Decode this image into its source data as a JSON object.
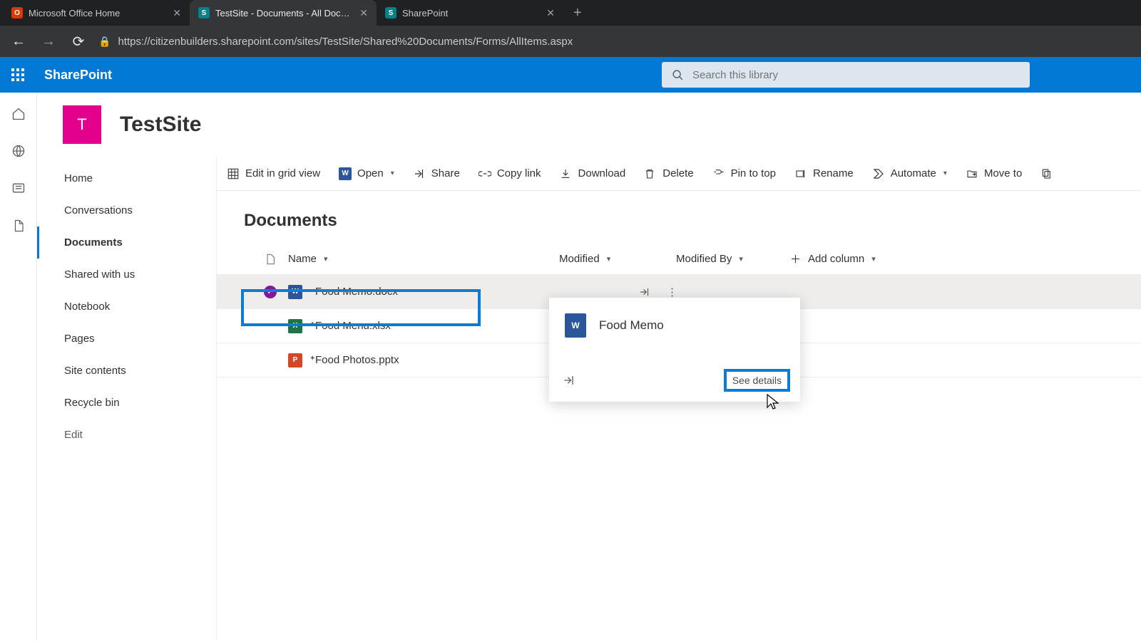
{
  "browser": {
    "tabs": [
      {
        "title": "Microsoft Office Home",
        "favicon": "office"
      },
      {
        "title": "TestSite - Documents - All Docu…",
        "favicon": "sp",
        "active": true
      },
      {
        "title": "SharePoint",
        "favicon": "sp"
      }
    ],
    "url": "https://citizenbuilders.sharepoint.com/sites/TestSite/Shared%20Documents/Forms/AllItems.aspx"
  },
  "suite": {
    "brand": "SharePoint",
    "search_placeholder": "Search this library"
  },
  "site": {
    "logo_letter": "T",
    "title": "TestSite",
    "logo_color": "#e3008c"
  },
  "left_nav": {
    "items": [
      "Home",
      "Conversations",
      "Documents",
      "Shared with us",
      "Notebook",
      "Pages",
      "Site contents",
      "Recycle bin"
    ],
    "selected_index": 2,
    "edit": "Edit"
  },
  "commands": {
    "edit_grid": "Edit in grid view",
    "open": "Open",
    "share": "Share",
    "copy_link": "Copy link",
    "download": "Download",
    "delete": "Delete",
    "pin": "Pin to top",
    "rename": "Rename",
    "automate": "Automate",
    "move": "Move to",
    "copy": "C"
  },
  "library": {
    "title": "Documents",
    "columns": {
      "name": "Name",
      "modified": "Modified",
      "modified_by": "Modified By",
      "add": "Add column"
    },
    "rows": [
      {
        "name": "Food Memo.docx",
        "type": "word",
        "selected": true
      },
      {
        "name": "Food Menu.xlsx",
        "type": "excel"
      },
      {
        "name": "Food Photos.pptx",
        "type": "ppt"
      }
    ]
  },
  "hover_card": {
    "title": "Food Memo",
    "see_details": "See details"
  }
}
